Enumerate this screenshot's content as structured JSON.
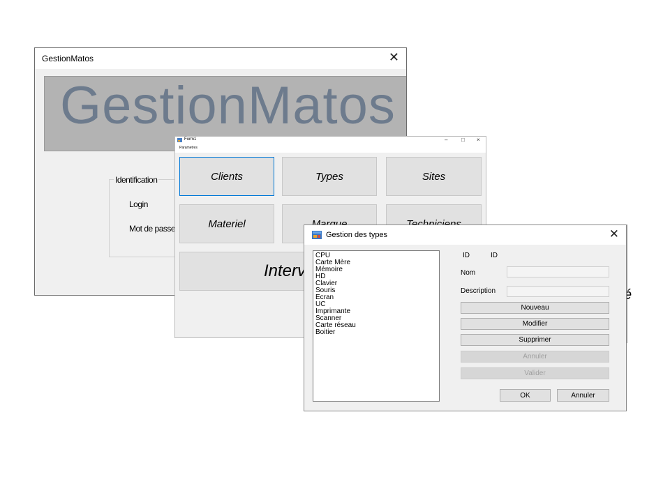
{
  "window1": {
    "title": "GestionMatos",
    "banner_text": "GestionMatos",
    "group_label": "Identification",
    "login_label": "Login",
    "password_label": "Mot de passe"
  },
  "window2": {
    "title": "Form1",
    "menu_item": "Parametres",
    "buttons": [
      "Clients",
      "Types",
      "Sites",
      "Materiel",
      "Marque",
      "Techniciens"
    ],
    "big_button": "Interventions"
  },
  "window3": {
    "title": "Gestion des types",
    "list_items": [
      "CPU",
      "Carte Mère",
      "Mémoire",
      "HD",
      "Clavier",
      "Souris",
      "Ecran",
      "UC",
      "Imprimante",
      "Scanner",
      "Carte réseau",
      "Boitier"
    ],
    "id_label": "ID",
    "id_value": "ID",
    "nom_label": "Nom",
    "description_label": "Description",
    "buttons": {
      "nouveau": "Nouveau",
      "modifier": "Modifier",
      "supprimer": "Supprimer",
      "annuler_disabled": "Annuler",
      "valider_disabled": "Valider",
      "ok": "OK",
      "annuler": "Annuler"
    }
  },
  "colors": {
    "banner_bg": "#b3b3b3",
    "banner_text": "#6d7b8d",
    "focus_border": "#0078d7"
  }
}
